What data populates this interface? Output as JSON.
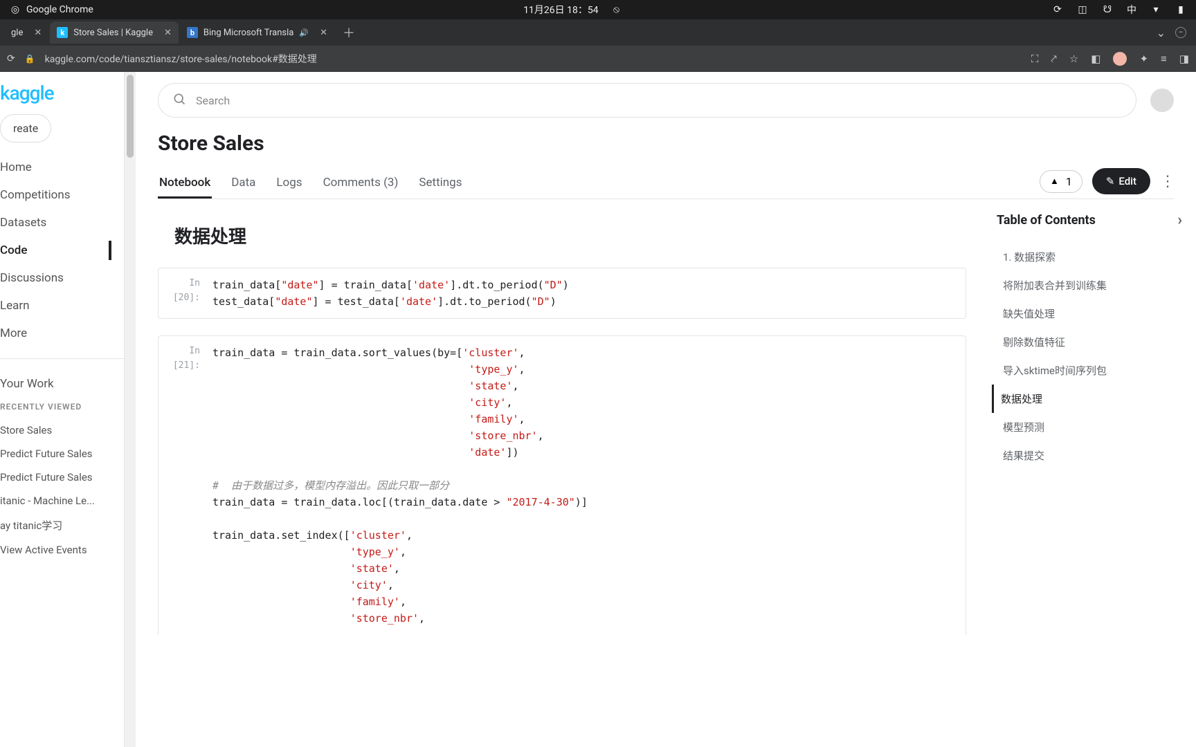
{
  "sysbar": {
    "app_name": "Google Chrome",
    "datetime": "11月26日  18：54",
    "ime": "中"
  },
  "tabs": [
    {
      "title": "gle"
    },
    {
      "title": "Store Sales | Kaggle",
      "active": true
    },
    {
      "title": "Bing Microsoft Transla"
    }
  ],
  "url": "kaggle.com/code/tiansztiansz/store-sales/notebook#数据处理",
  "sidebar": {
    "logo": "kaggle",
    "create": "reate",
    "nav": [
      {
        "label": "Home"
      },
      {
        "label": "Competitions"
      },
      {
        "label": "Datasets"
      },
      {
        "label": "Code",
        "active": true
      },
      {
        "label": "Discussions"
      },
      {
        "label": "Learn"
      },
      {
        "label": "More"
      }
    ],
    "your_work": "Your Work",
    "recent_header": "RECENTLY VIEWED",
    "recent": [
      "Store Sales",
      "Predict Future Sales",
      "Predict Future Sales",
      "itanic - Machine Le...",
      "ay titanic学习",
      "View Active Events"
    ]
  },
  "search": {
    "placeholder": "Search"
  },
  "page": {
    "title": "Store Sales",
    "tabs": [
      {
        "label": "Notebook",
        "active": true
      },
      {
        "label": "Data"
      },
      {
        "label": "Logs"
      },
      {
        "label": "Comments (3)"
      },
      {
        "label": "Settings"
      }
    ],
    "upvote_count": "1",
    "edit_label": "Edit"
  },
  "notebook": {
    "heading": "数据处理",
    "cells": [
      {
        "prompt": "In [20]:"
      },
      {
        "prompt": "In [21]:"
      }
    ]
  },
  "toc": {
    "title": "Table of Contents",
    "items": [
      {
        "label": "1. 数据探索"
      },
      {
        "label": "将附加表合并到训练集"
      },
      {
        "label": "缺失值处理"
      },
      {
        "label": "剔除数值特征"
      },
      {
        "label": "导入sktime时间序列包"
      },
      {
        "label": "数据处理",
        "current": true
      },
      {
        "label": "模型预测",
        "cursor": true
      },
      {
        "label": "结果提交"
      }
    ]
  },
  "code": {
    "cell1_line1_a": "train_data[",
    "cell1_line1_b": "] = train_data[",
    "cell1_line1_c": "].dt.to_period(",
    "cell1_line1_d": ")",
    "cell1_line2_a": "test_data[",
    "cell1_line2_b": "] = test_data[",
    "cell1_line2_c": "].dt.to_period(",
    "cell1_line2_d": ")",
    "date_dq": "\"date\"",
    "date_sq": "'date'",
    "D_dq": "\"D\"",
    "cluster": "'cluster'",
    "type_y": "'type_y'",
    "state": "'state'",
    "city": "'city'",
    "family": "'family'",
    "store_nbr": "'store_nbr'",
    "date2": "'date'",
    "date_lit": "\"2017-4-30\"",
    "comment": "#  由于数据过多，模型内存溢出。因此只取一部分",
    "c2_l1": "train_data = train_data.sort_values(by=[",
    "c2_l9a": "train_data = train_data.loc[(train_data.date > ",
    "c2_l9b": ")]",
    "c2_l10": "train_data.set_index(["
  }
}
